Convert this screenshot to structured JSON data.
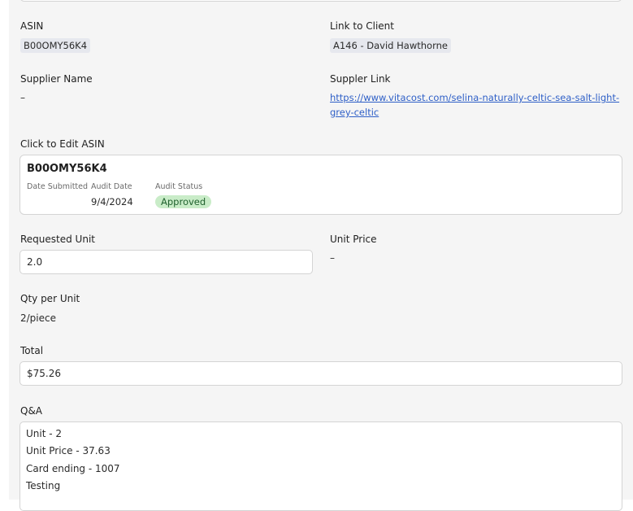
{
  "asin_section": {
    "label": "ASIN",
    "value": "B00OMY56K4"
  },
  "client_section": {
    "label": "Link to Client",
    "value": "A146 - David Hawthorne"
  },
  "supplier_name": {
    "label": "Supplier Name",
    "value": "–"
  },
  "supplier_link": {
    "label": "Suppler Link",
    "url": "https://www.vitacost.com/selina-naturally-celtic-sea-salt-light-grey-celtic"
  },
  "edit_asin": {
    "label": "Click to Edit ASIN",
    "card": {
      "title": "B00OMY56K4",
      "date_submitted_label": "Date Submitted",
      "date_submitted_value": "",
      "audit_date_label": "Audit Date",
      "audit_date_value": "9/4/2024",
      "audit_status_label": "Audit Status",
      "audit_status_value": "Approved",
      "status_color": "#c9ecc8"
    }
  },
  "requested_unit": {
    "label": "Requested Unit",
    "value": "2.0"
  },
  "unit_price": {
    "label": "Unit Price",
    "value": "–"
  },
  "qty_per_unit": {
    "label": "Qty per Unit",
    "value": "2/piece"
  },
  "total": {
    "label": "Total",
    "value": "$75.26"
  },
  "qa": {
    "label": "Q&A",
    "lines": [
      "Unit - 2",
      "Unit Price - 37.63",
      "Card ending - 1007",
      "Testing"
    ]
  },
  "colors": {
    "link": "#2e5fc7",
    "panel_bg": "#f5f5f5"
  }
}
